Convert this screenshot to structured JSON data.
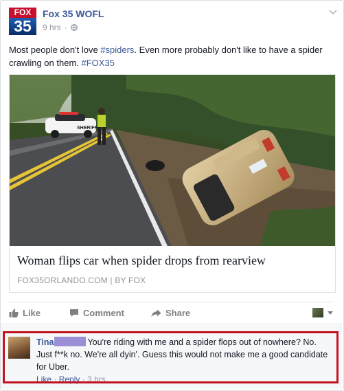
{
  "post": {
    "page_name": "Fox 35 WOFL",
    "avatar": {
      "top_text": "FOX",
      "number": "35"
    },
    "time": "9 hrs",
    "separator": "·",
    "text_parts": [
      "Most people don't love ",
      "#spiders",
      ". Even more probably don't like to have a spider crawling on them. ",
      "#FOX35"
    ]
  },
  "link_card": {
    "title": "Woman flips car when spider drops from rearview",
    "source": "FOX35ORLANDO.COM | BY FOX",
    "photo_police_car_text": "SHERIFF"
  },
  "actions": {
    "like": "Like",
    "comment": "Comment",
    "share": "Share"
  },
  "comment": {
    "name": "Tina",
    "text": "You're riding with me and a spider flops out of nowhere? No. Just f**k no. We're all dyin'. Guess this would not make me a good candidate for Uber.",
    "like": "Like",
    "reply": "Reply",
    "time": "3 hrs",
    "sep": "·"
  },
  "colors": {
    "link_blue": "#3b5998",
    "highlight_red": "#c1121f",
    "muted_gray": "#9197a3",
    "redaction_purple": "#9b8fd6"
  },
  "icons": [
    "globe-icon",
    "chevron-down-icon",
    "thumbs-up-icon",
    "comment-icon",
    "share-arrow-icon"
  ]
}
